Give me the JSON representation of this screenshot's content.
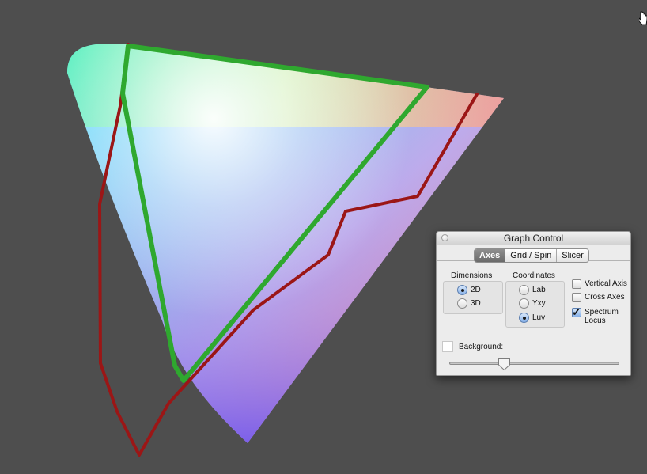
{
  "panel": {
    "title": "Graph Control",
    "tabs": [
      {
        "label": "Axes",
        "active": true
      },
      {
        "label": "Grid / Spin",
        "active": false
      },
      {
        "label": "Slicer",
        "active": false
      }
    ],
    "dimensions": {
      "label": "Dimensions",
      "options": [
        {
          "label": "2D",
          "checked": true
        },
        {
          "label": "3D",
          "checked": false
        }
      ]
    },
    "coordinates": {
      "label": "Coordinates",
      "options": [
        {
          "label": "Lab",
          "checked": false
        },
        {
          "label": "Yxy",
          "checked": false
        },
        {
          "label": "Luv",
          "checked": true
        }
      ]
    },
    "checkboxes": [
      {
        "label": "Vertical Axis",
        "checked": false
      },
      {
        "label": "Cross Axes",
        "checked": false
      },
      {
        "label": "Spectrum Locus",
        "checked": true
      }
    ],
    "background": {
      "label": "Background:",
      "swatch_color": "#ffffff",
      "slider_value": 0.33
    }
  },
  "graph": {
    "background_color": "#4e4e4e",
    "gamut_outlines": [
      {
        "color": "#2fa82f"
      },
      {
        "color": "#9b1616"
      }
    ]
  }
}
